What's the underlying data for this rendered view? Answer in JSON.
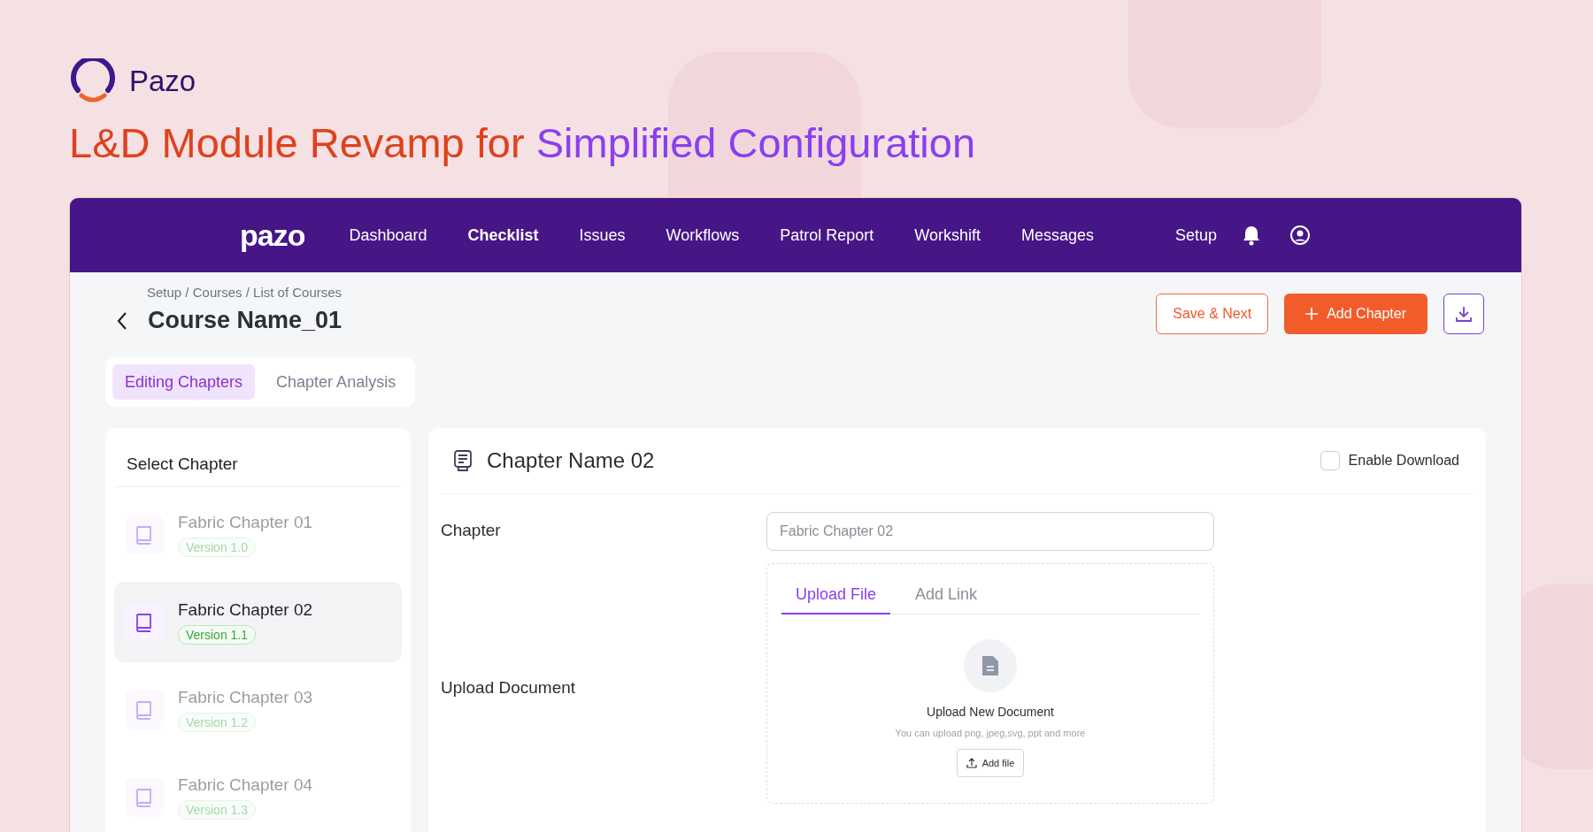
{
  "brand": {
    "name": "Pazo"
  },
  "headline": {
    "part_1": "L&D Module Revamp for",
    "part_2": "Simplified Configuration"
  },
  "app": {
    "logo": "pazo",
    "nav": [
      {
        "label": "Dashboard",
        "selected": false
      },
      {
        "label": "Checklist",
        "selected": true
      },
      {
        "label": "Issues",
        "selected": false
      },
      {
        "label": "Workflows",
        "selected": false
      },
      {
        "label": "Patrol Report",
        "selected": false
      },
      {
        "label": "Workshift",
        "selected": false
      },
      {
        "label": "Messages",
        "selected": false
      }
    ],
    "setup": "Setup",
    "breadcrumb": "Setup / Courses / List of Courses",
    "title": "Course Name_01",
    "actions": {
      "save": "Save & Next",
      "add": "Add Chapter"
    },
    "tabs": [
      {
        "label": "Editing Chapters",
        "selected": true
      },
      {
        "label": "Chapter Analysis",
        "selected": false
      }
    ],
    "chapter_list": {
      "title": "Select Chapter",
      "items": [
        {
          "name": "Fabric Chapter 01",
          "version": "Version 1.0",
          "selected": false
        },
        {
          "name": "Fabric Chapter 02",
          "version": "Version 1.1",
          "selected": true
        },
        {
          "name": "Fabric Chapter 03",
          "version": "Version 1.2",
          "selected": false
        },
        {
          "name": "Fabric Chapter 04",
          "version": "Version 1.3",
          "selected": false
        }
      ]
    },
    "editor": {
      "title": "Chapter Name 02",
      "enable_download": {
        "label": "Enable Download",
        "checked": false
      },
      "chapter_label": "Chapter",
      "chapter_placeholder": "Fabric Chapter 02",
      "upload_label": "Upload Document",
      "upload_tabs": [
        {
          "label": "Upload File",
          "selected": true
        },
        {
          "label": "Add Link",
          "selected": false
        }
      ],
      "upload_title": "Upload New Document",
      "upload_hint": "You can upload png, jpeg,svg, ppt and more",
      "add_file": "Add file"
    }
  }
}
